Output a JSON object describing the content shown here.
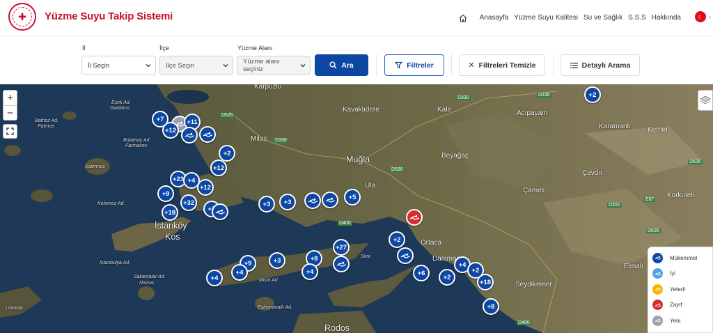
{
  "header": {
    "app_title": "Yüzme Suyu Takip Sistemi",
    "nav": [
      {
        "label": "Anasayfa"
      },
      {
        "label": "Yüzme Suyu Kalitesi"
      },
      {
        "label": "Su ve Sağlık"
      },
      {
        "label": "S.S.S"
      },
      {
        "label": "Hakkında"
      }
    ],
    "language_icon": "turkish-flag-icon"
  },
  "filters": {
    "il": {
      "label": "İl",
      "value": "İl Seçin"
    },
    "ilce": {
      "label": "İlçe",
      "value": "İlçe Seçin"
    },
    "alan": {
      "label": "Yüzme Alanı",
      "value": "Yüzme alanı seçiniz"
    },
    "search_button": "Ara",
    "filters_button": "Filtreler",
    "clear_button": "Filtreleri Temizle",
    "detailed_button": "Detaylı Arama"
  },
  "map": {
    "zoom_in": "+",
    "zoom_out": "−",
    "places": [
      {
        "name": "Muğla",
        "size": "big"
      },
      {
        "name": "Kavaklıdere",
        "size": "med"
      },
      {
        "name": "Milas",
        "size": "med"
      },
      {
        "name": "Kale",
        "size": "med"
      },
      {
        "name": "Acıpayam",
        "size": "med"
      },
      {
        "name": "Karamanlı",
        "size": "med"
      },
      {
        "name": "Kemer",
        "size": "med"
      },
      {
        "name": "Beyağaç",
        "size": "med"
      },
      {
        "name": "Çavdır",
        "size": "med"
      },
      {
        "name": "Çameli",
        "size": "med"
      },
      {
        "name": "Korkuteli",
        "size": "med"
      },
      {
        "name": "Ula",
        "size": "med"
      },
      {
        "name": "Ortaca",
        "size": "med"
      },
      {
        "name": "Dalaman",
        "size": "med"
      },
      {
        "name": "Seydikemer",
        "size": "med"
      },
      {
        "name": "Elmalı",
        "size": "med"
      },
      {
        "name": "İstanköy",
        "size": "big"
      },
      {
        "name": "Kos",
        "size": "big"
      },
      {
        "name": "Rodos",
        "size": "big"
      },
      {
        "name": "Karpuzlu",
        "size": "med"
      },
      {
        "name": "Eşek Ad.",
        "size": "small"
      },
      {
        "name": "Gaidaros",
        "size": "small"
      },
      {
        "name": "Batnoz Ad.",
        "size": "small"
      },
      {
        "name": "Patmos",
        "size": "small"
      },
      {
        "name": "Bulamaç Ad.",
        "size": "small"
      },
      {
        "name": "Farmakos",
        "size": "small"
      },
      {
        "name": "Kalimnos",
        "size": "small"
      },
      {
        "name": "Kelemez Ad.",
        "size": "small"
      },
      {
        "name": "İstanbulya Ad.",
        "size": "small"
      },
      {
        "name": "Sakarcalar Ad.",
        "size": "small"
      },
      {
        "name": "Nisiros",
        "size": "small"
      },
      {
        "name": "Misiri Ad.",
        "size": "small"
      },
      {
        "name": "Eskianavatlı Ad.",
        "size": "small"
      },
      {
        "name": "Limonia",
        "size": "small"
      },
      {
        "name": "Simi",
        "size": "small"
      }
    ],
    "roads": [
      "D525",
      "D330",
      "D330",
      "D330",
      "D330",
      "D400",
      "D350",
      "E87",
      "D635",
      "D635",
      "D400"
    ],
    "markers": [
      {
        "label": "+2",
        "type": "count"
      },
      {
        "label": "+7",
        "type": "count"
      },
      {
        "label": "",
        "type": "new"
      },
      {
        "label": "+11",
        "type": "count"
      },
      {
        "label": "+12",
        "type": "count"
      },
      {
        "label": "",
        "type": "excellent"
      },
      {
        "label": "",
        "type": "excellent"
      },
      {
        "label": "+2",
        "type": "count"
      },
      {
        "label": "+12",
        "type": "count"
      },
      {
        "label": "+23",
        "type": "count"
      },
      {
        "label": "+4",
        "type": "count"
      },
      {
        "label": "+12",
        "type": "count"
      },
      {
        "label": "+9",
        "type": "count"
      },
      {
        "label": "+32",
        "type": "count"
      },
      {
        "label": "+7",
        "type": "count"
      },
      {
        "label": "",
        "type": "excellent"
      },
      {
        "label": "+18",
        "type": "count"
      },
      {
        "label": "+3",
        "type": "count"
      },
      {
        "label": "+3",
        "type": "count"
      },
      {
        "label": "",
        "type": "excellent"
      },
      {
        "label": "",
        "type": "excellent"
      },
      {
        "label": "+5",
        "type": "count"
      },
      {
        "label": "",
        "type": "poor"
      },
      {
        "label": "+2",
        "type": "count"
      },
      {
        "label": "+27",
        "type": "count"
      },
      {
        "label": "+8",
        "type": "count"
      },
      {
        "label": "+9",
        "type": "count"
      },
      {
        "label": "+3",
        "type": "count"
      },
      {
        "label": "",
        "type": "excellent"
      },
      {
        "label": "+4",
        "type": "count"
      },
      {
        "label": "+4",
        "type": "count"
      },
      {
        "label": "+4",
        "type": "count"
      },
      {
        "label": "",
        "type": "excellent"
      },
      {
        "label": "+6",
        "type": "count"
      },
      {
        "label": "+2",
        "type": "count"
      },
      {
        "label": "+4",
        "type": "count"
      },
      {
        "label": "+2",
        "type": "count"
      },
      {
        "label": "+18",
        "type": "count"
      },
      {
        "label": "+8",
        "type": "count"
      }
    ],
    "legend": [
      {
        "label": "Mükemmel",
        "color": "#0d47a1"
      },
      {
        "label": "İyi",
        "color": "#4fa3e0"
      },
      {
        "label": "Yeterli",
        "color": "#f2b705"
      },
      {
        "label": "Zayıf",
        "color": "#d32f2f"
      },
      {
        "label": "Yeni",
        "color": "#9aa3ad"
      }
    ]
  }
}
